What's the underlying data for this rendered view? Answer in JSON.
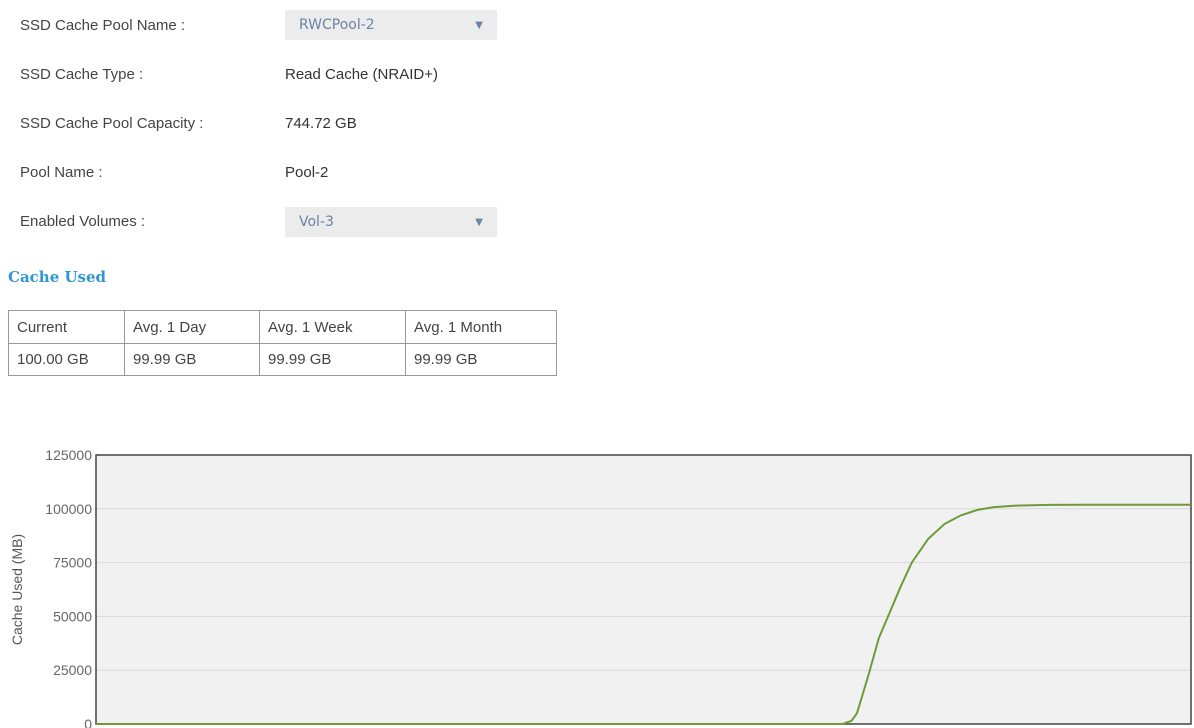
{
  "form": {
    "ssd_cache_pool_name": {
      "label": "SSD Cache Pool Name :",
      "value": "RWCPool-2"
    },
    "ssd_cache_type": {
      "label": "SSD Cache Type :",
      "value": "Read Cache (NRAID+)"
    },
    "ssd_cache_pool_capacity": {
      "label": "SSD Cache Pool Capacity :",
      "value": "744.72 GB"
    },
    "pool_name": {
      "label": "Pool Name :",
      "value": "Pool-2"
    },
    "enabled_volumes": {
      "label": "Enabled Volumes :",
      "value": "Vol-3"
    }
  },
  "cache_used": {
    "title": "Cache Used",
    "headers": [
      "Current",
      "Avg. 1 Day",
      "Avg. 1 Week",
      "Avg. 1 Month"
    ],
    "values": [
      "100.00 GB",
      "99.99 GB",
      "99.99 GB",
      "99.99 GB"
    ]
  },
  "icons": {
    "dropdown": "triangle-down-icon"
  },
  "colors": {
    "accent": "#2f96d6",
    "line": "#6f9a3a",
    "plot_bg": "#f1f1f1"
  },
  "chart_data": {
    "type": "line",
    "title": "",
    "xlabel": "",
    "ylabel": "Cache Used (MB)",
    "ylim": [
      0,
      125000
    ],
    "xlim": [
      0,
      100
    ],
    "yticks": [
      0,
      25000,
      50000,
      75000,
      100000,
      125000
    ],
    "grid": true,
    "series": [
      {
        "x": [
          0,
          10,
          20,
          30,
          40,
          50,
          60,
          68.2,
          69.0,
          69.5,
          70.5,
          71.5,
          72.5,
          73.5,
          74.5,
          76,
          77.5,
          79,
          80.5,
          82,
          84,
          87,
          90,
          95,
          100
        ],
        "y": [
          0,
          0,
          0,
          0,
          0,
          0,
          0,
          0,
          1500,
          5000,
          22000,
          40000,
          52000,
          64000,
          75000,
          86000,
          93000,
          97000,
          99500,
          100800,
          101500,
          101800,
          101900,
          101900,
          101900
        ]
      }
    ]
  }
}
